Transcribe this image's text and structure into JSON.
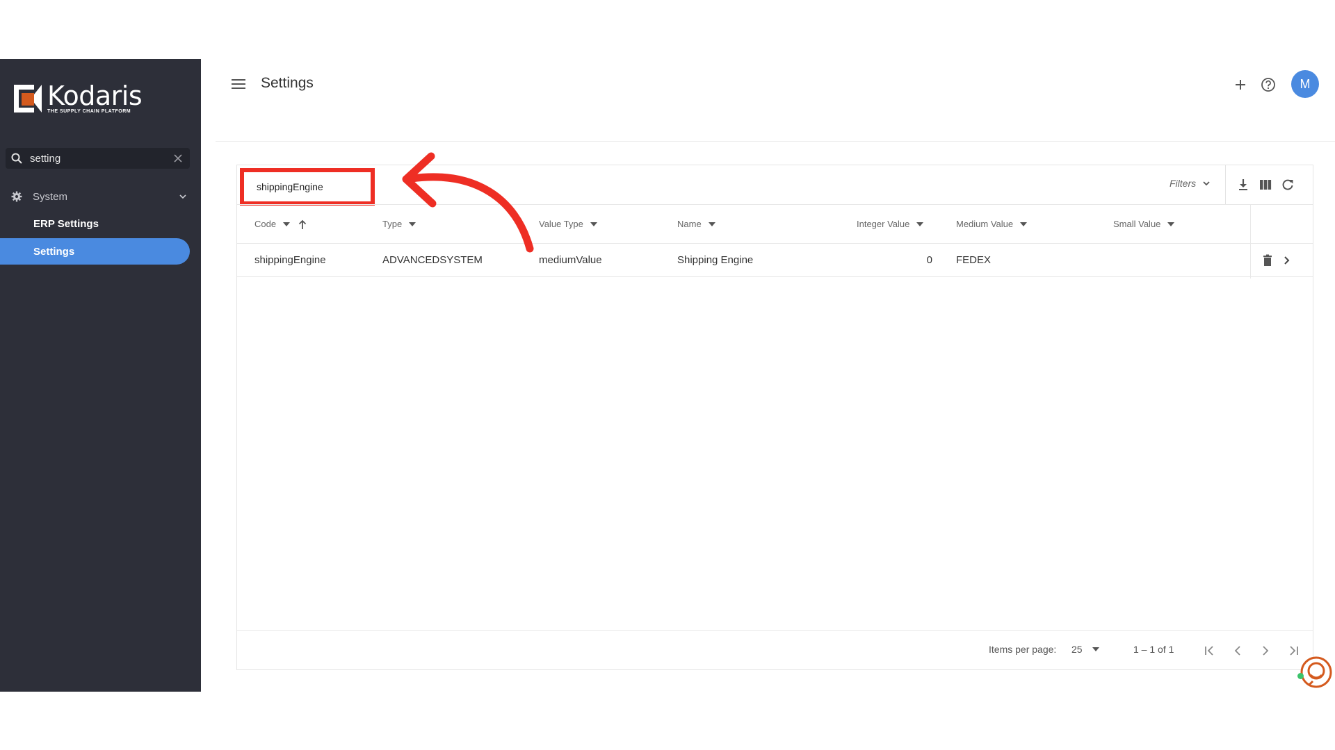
{
  "sidebar": {
    "logo_name": "Kodaris",
    "logo_tagline": "THE SUPPLY CHAIN PLATFORM",
    "search_value": "setting",
    "group_label": "System",
    "items": [
      {
        "label": "ERP Settings",
        "active": false
      },
      {
        "label": "Settings",
        "active": true
      }
    ]
  },
  "header": {
    "title": "Settings",
    "avatar_initial": "M",
    "icons": [
      "menu-icon",
      "plus-icon",
      "help-icon"
    ]
  },
  "toolbar": {
    "code_filter_value": "shippingEngine",
    "filters_label": "Filters",
    "icons": [
      "download-icon",
      "columns-icon",
      "refresh-icon"
    ]
  },
  "table": {
    "columns": [
      "Code",
      "Type",
      "Value Type",
      "Name",
      "Integer Value",
      "Medium Value",
      "Small Value"
    ],
    "rows": [
      {
        "code": "shippingEngine",
        "type": "ADVANCEDSYSTEM",
        "value_type": "mediumValue",
        "name": "Shipping Engine",
        "integer_value": "0",
        "medium_value": "FEDEX",
        "small_value": ""
      }
    ]
  },
  "pagination": {
    "items_per_page_label": "Items per page:",
    "items_per_page": "25",
    "range": "1 – 1 of 1"
  },
  "colors": {
    "sidebar_bg": "#2d2f39",
    "accent": "#4a8ae0",
    "annotation": "#ee2e24",
    "brand_orange": "#d45a1e"
  }
}
